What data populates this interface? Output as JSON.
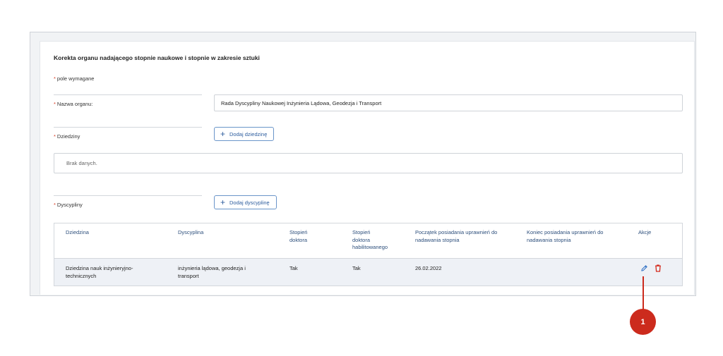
{
  "form": {
    "title": "Korekta organu nadającego stopnie naukowe i stopnie w zakresie sztuki",
    "required_marker": "*",
    "required_note": "pole wymagane",
    "name_label": "Nazwa organu:",
    "name_value": "Rada Dyscypliny Naukowej Inżynieria Lądowa, Geodezja i Transport",
    "domains_label": "Dziedziny",
    "add_domain_label": "Dodaj dziedzinę",
    "domains_empty": "Brak danych.",
    "disciplines_label": "Dyscypliny",
    "add_discipline_label": "Dodaj dyscyplinę",
    "add_icon": "plus-icon"
  },
  "table": {
    "headers": [
      "Dziedzina",
      "Dyscyplina",
      "Stopień doktora",
      "Stopień doktora habilitowanego",
      "Początek posiadania uprawnień do nadawania stopnia",
      "Koniec posiadania uprawnień do nadawania stopnia",
      "Akcje"
    ],
    "header_lines": [
      [
        "Dziedzina"
      ],
      [
        "Dyscyplina"
      ],
      [
        "Stopień",
        "doktora"
      ],
      [
        "Stopień",
        "doktora",
        "habilitowanego"
      ],
      [
        "Początek posiadania uprawnień do",
        "nadawania stopnia"
      ],
      [
        "Koniec posiadania uprawnień do",
        "nadawania stopnia"
      ],
      [
        "Akcje"
      ]
    ],
    "rows": [
      {
        "domain_lines": [
          "Dziedzina nauk inżynieryjno-",
          "technicznych"
        ],
        "discipline_lines": [
          "inżynieria lądowa, geodezja i",
          "transport"
        ],
        "doctor": "Tak",
        "habilitation": "Tak",
        "start": "26.02.2022",
        "end": "",
        "actions": [
          {
            "icon": "pencil-icon",
            "color": "#2d6fc4"
          },
          {
            "icon": "trash-icon",
            "color": "#d42a1c"
          }
        ]
      }
    ]
  },
  "callout": {
    "label": "1",
    "color": "#cc2b1d"
  }
}
